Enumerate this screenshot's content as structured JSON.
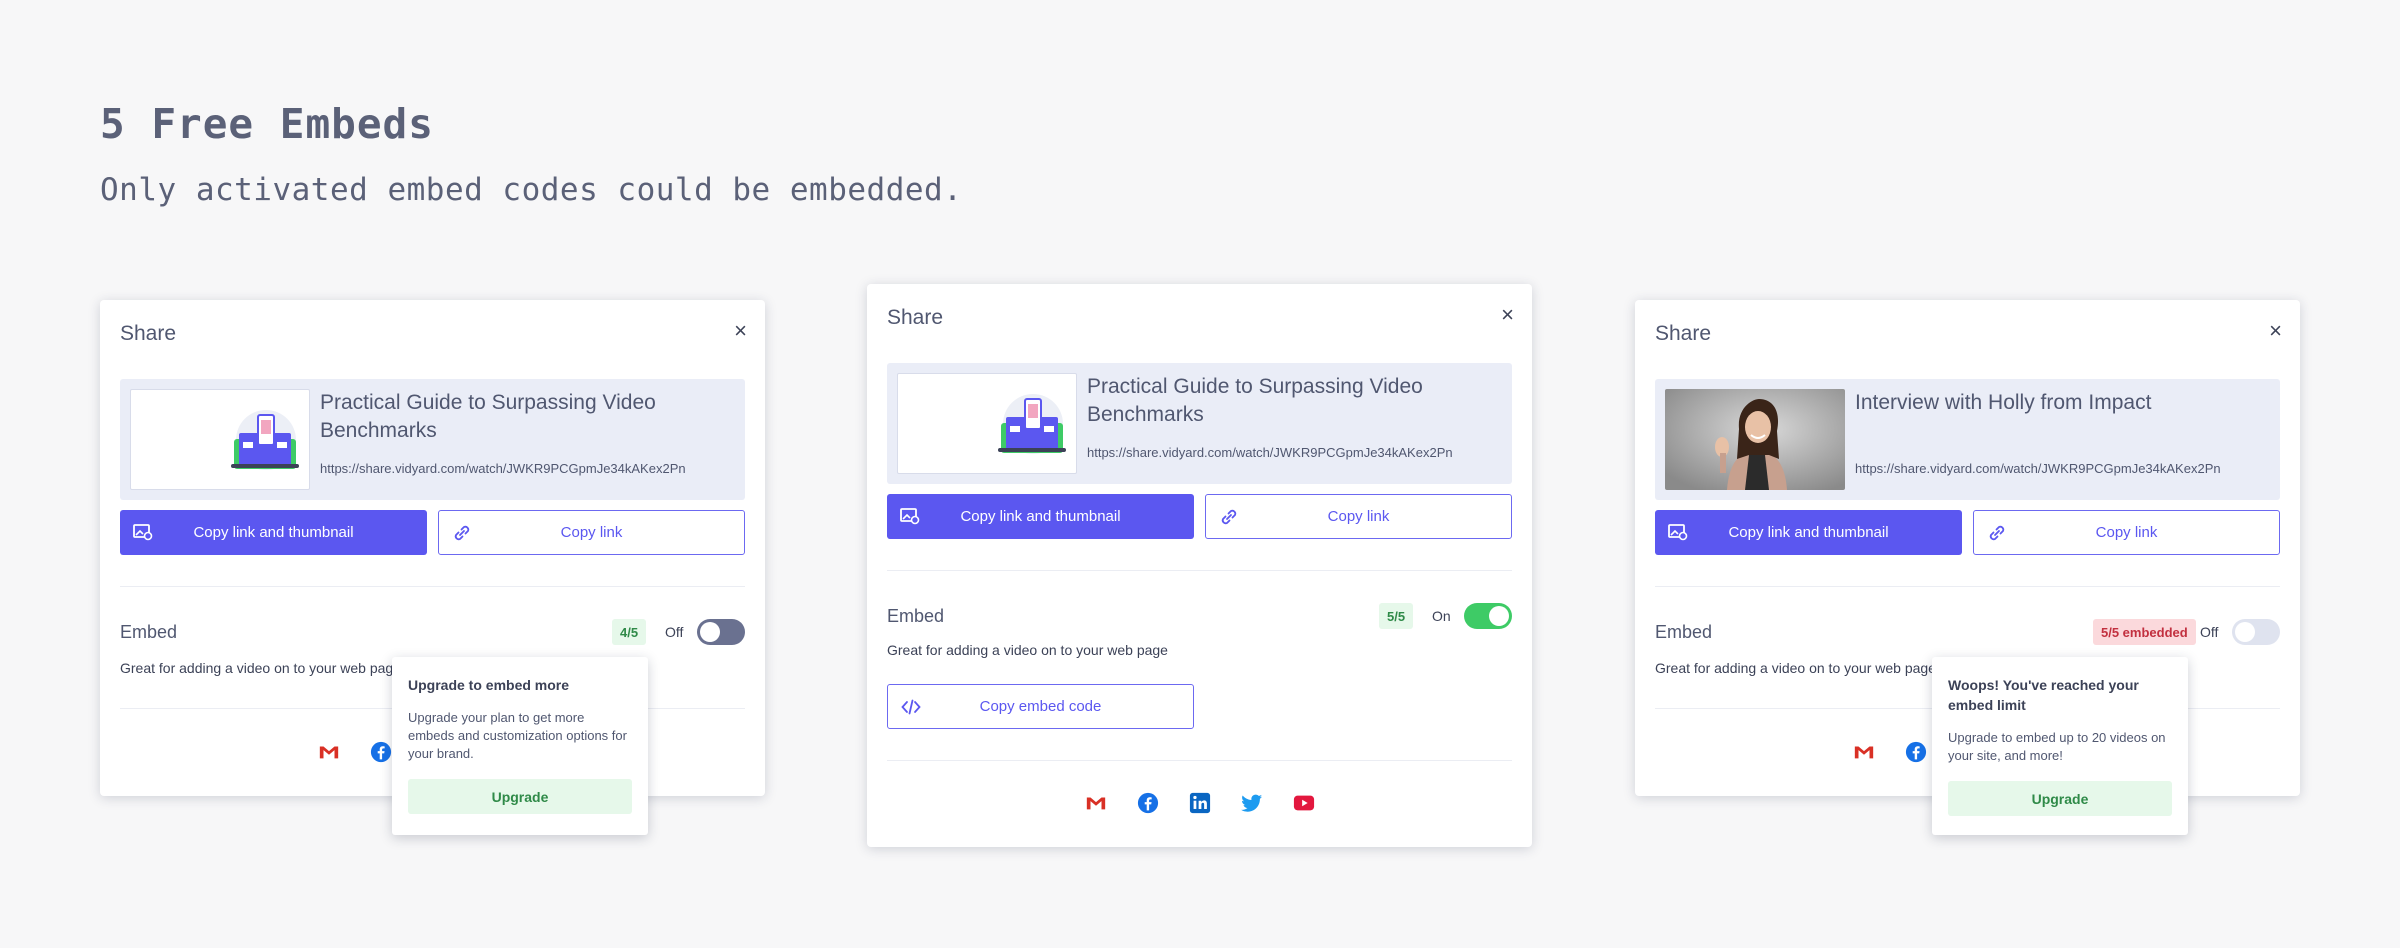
{
  "hero": {
    "title": "5 Free Embeds",
    "subtitle": "Only activated embed codes could be embedded."
  },
  "colors": {
    "accent": "#5b57f0",
    "toggle_on": "#3ecb66",
    "badge_red": "#c2303f"
  },
  "cards": [
    {
      "title": "Share",
      "close_icon": "×",
      "video_title": "Practical Guide to Surpassing Video Benchmarks",
      "video_url": "https://share.vidyard.com/watch/JWKR9PCGpmJe34kAKex2Pn",
      "copy_thumb_label": "Copy link and thumbnail",
      "copy_link_label": "Copy link",
      "embed_label": "Embed",
      "embed_desc": "Great for adding a video on to your web page",
      "count": "4/5",
      "toggle_state": "Off",
      "popover": {
        "title": "Upgrade to embed more",
        "text": "Upgrade your plan to get more embeds and customization options for your brand.",
        "button": "Upgrade"
      }
    },
    {
      "title": "Share",
      "close_icon": "×",
      "video_title": "Practical Guide to Surpassing Video Benchmarks",
      "video_url": "https://share.vidyard.com/watch/JWKR9PCGpmJe34kAKex2Pn",
      "copy_thumb_label": "Copy link and thumbnail",
      "copy_link_label": "Copy link",
      "embed_label": "Embed",
      "embed_desc": "Great for adding a video on to your web page",
      "count": "5/5",
      "toggle_state": "On",
      "embed_code_label": "Copy embed code"
    },
    {
      "title": "Share",
      "close_icon": "×",
      "video_title": "Interview with Holly from Impact",
      "video_url": "https://share.vidyard.com/watch/JWKR9PCGpmJe34kAKex2Pn",
      "copy_thumb_label": "Copy link and thumbnail",
      "copy_link_label": "Copy link",
      "embed_label": "Embed",
      "embed_desc": "Great for adding a video on to your web page",
      "count": "5/5 embedded",
      "toggle_state": "Off",
      "popover": {
        "title": "Woops! You've reached your embed limit",
        "text": "Upgrade to embed up to 20 videos on your site, and more!",
        "button": "Upgrade"
      }
    }
  ],
  "social_icons": [
    "gmail-icon",
    "facebook-icon",
    "linkedin-icon",
    "twitter-icon",
    "youtube-icon"
  ]
}
